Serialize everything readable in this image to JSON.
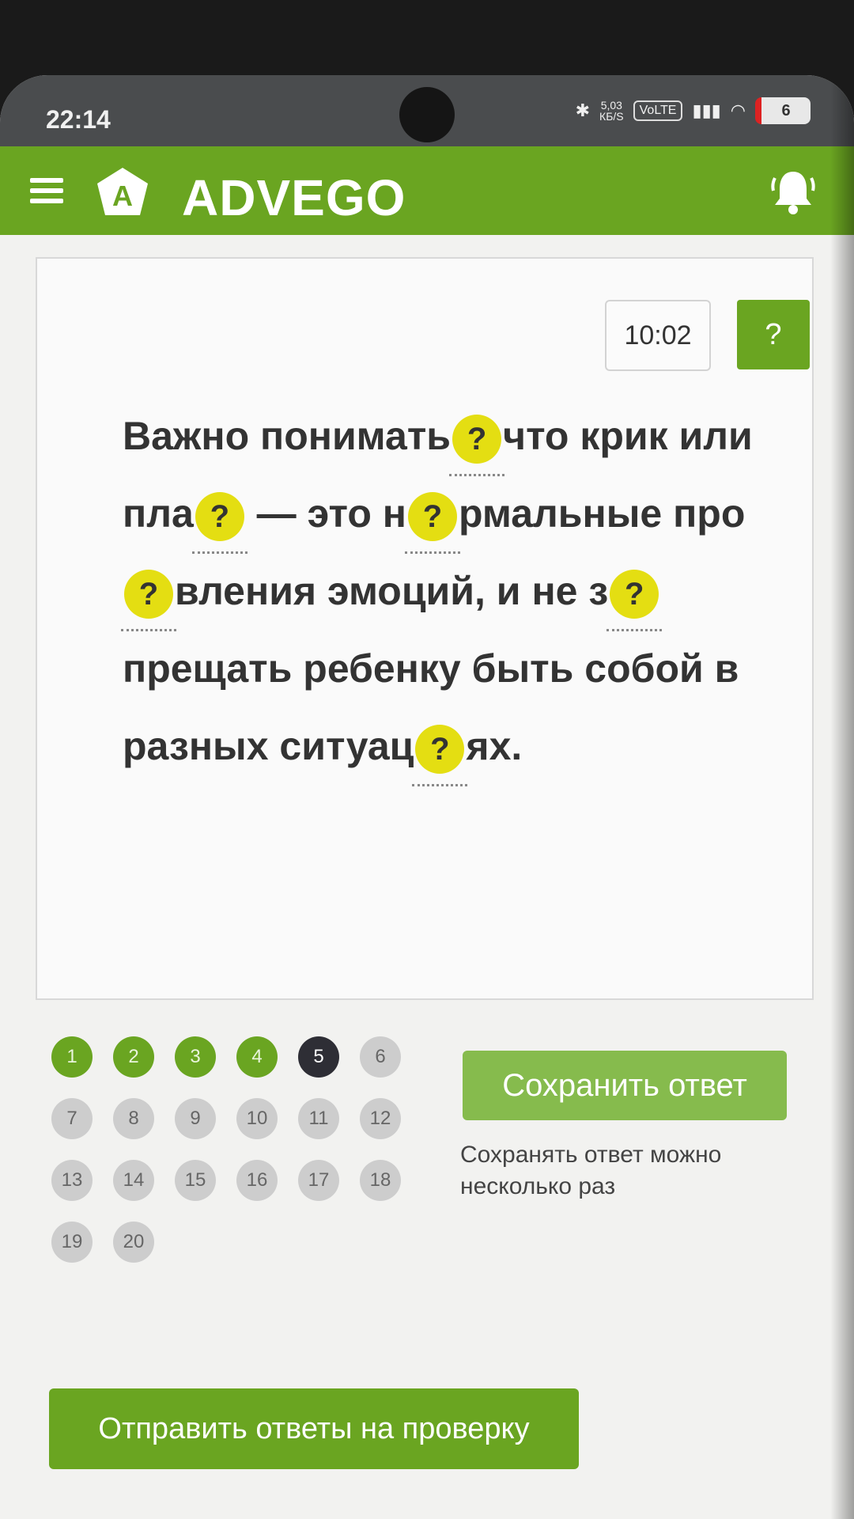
{
  "status_bar": {
    "time": "22:14",
    "net_speed_value": "5,03",
    "net_speed_unit": "КБ/S",
    "volte": "VoLTE",
    "battery": "6"
  },
  "header": {
    "app_name": "ADVEGO",
    "logo_letter": "A",
    "brand_color": "#6aa521"
  },
  "quiz": {
    "timer": "10:02",
    "help_label": "?",
    "gap_symbol": "?",
    "fragments": [
      "Важно понимать",
      "что крик или пла",
      " — это н",
      "рмальные про",
      "вления эмоций, и не з",
      "прещать ребенку быть собой в разных ситуац",
      "ях."
    ],
    "questions": [
      {
        "n": "1",
        "state": "done"
      },
      {
        "n": "2",
        "state": "done"
      },
      {
        "n": "3",
        "state": "done"
      },
      {
        "n": "4",
        "state": "done"
      },
      {
        "n": "5",
        "state": "current"
      },
      {
        "n": "6",
        "state": "pending"
      },
      {
        "n": "7",
        "state": "pending"
      },
      {
        "n": "8",
        "state": "pending"
      },
      {
        "n": "9",
        "state": "pending"
      },
      {
        "n": "10",
        "state": "pending"
      },
      {
        "n": "11",
        "state": "pending"
      },
      {
        "n": "12",
        "state": "pending"
      },
      {
        "n": "13",
        "state": "pending"
      },
      {
        "n": "14",
        "state": "pending"
      },
      {
        "n": "15",
        "state": "pending"
      },
      {
        "n": "16",
        "state": "pending"
      },
      {
        "n": "17",
        "state": "pending"
      },
      {
        "n": "18",
        "state": "pending"
      },
      {
        "n": "19",
        "state": "pending"
      },
      {
        "n": "20",
        "state": "pending"
      }
    ],
    "save_label": "Сохранить ответ",
    "save_note": "Сохранять ответ можно несколько раз",
    "submit_label": "Отправить ответы на проверку"
  }
}
